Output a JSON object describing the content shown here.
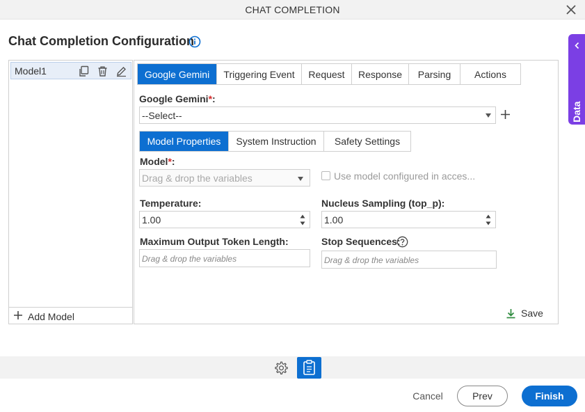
{
  "window": {
    "title": "CHAT COMPLETION"
  },
  "page": {
    "heading": "Chat Completion Configuration"
  },
  "app_data": {
    "label": "App Data"
  },
  "models": {
    "items": [
      {
        "label": "Model1"
      }
    ],
    "add_label": "Add Model"
  },
  "tabs_main": [
    {
      "label": "Google Gemini",
      "active": true
    },
    {
      "label": "Triggering Event",
      "active": false
    },
    {
      "label": "Request",
      "active": false
    },
    {
      "label": "Response",
      "active": false
    },
    {
      "label": "Parsing",
      "active": false
    },
    {
      "label": "Actions",
      "active": false
    }
  ],
  "gemini": {
    "label": "Google Gemini",
    "required_mark": "*",
    "label_suffix": ":",
    "value": "--Select--"
  },
  "tabs_sub": [
    {
      "label": "Model Properties",
      "active": true
    },
    {
      "label": "System Instruction",
      "active": false
    },
    {
      "label": "Safety Settings",
      "active": false
    }
  ],
  "fields": {
    "model": {
      "label": "Model",
      "required_mark": "*",
      "suffix": ":",
      "placeholder": "Drag & drop the variables"
    },
    "use_model": {
      "label": "Use model configured in acces...",
      "checked": false
    },
    "temperature": {
      "label": "Temperature:",
      "value": "1.00"
    },
    "top_p": {
      "label": "Nucleus Sampling (top_p):",
      "value": "1.00"
    },
    "max_tokens": {
      "label": "Maximum Output Token Length:",
      "placeholder": "Drag & drop the variables"
    },
    "stop_sequences": {
      "label": "Stop Sequences:",
      "placeholder": "Drag & drop the variables"
    }
  },
  "save": {
    "label": "Save"
  },
  "footer": {
    "cancel": "Cancel",
    "prev": "Prev",
    "finish": "Finish"
  },
  "colors": {
    "accent": "#0d6fd1",
    "app_data": "#7b3fe4",
    "required": "#d62c2c",
    "save_icon": "#2e8b3e"
  },
  "icons": {
    "close": "close-icon",
    "info": "info-icon",
    "chevron": "chevron-left-icon",
    "copy": "copy-icon",
    "delete": "trash-icon",
    "edit": "pencil-icon",
    "plus": "plus-icon",
    "help": "help-icon",
    "save": "download-icon",
    "settings": "gear-icon",
    "clipboard": "clipboard-icon"
  }
}
